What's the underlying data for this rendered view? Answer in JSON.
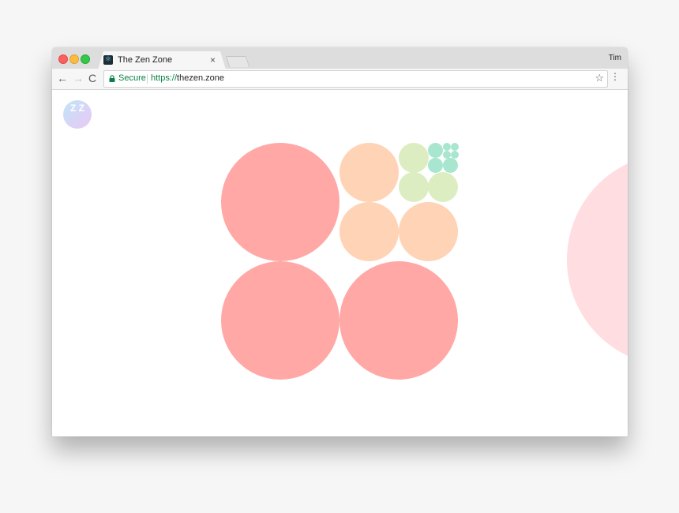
{
  "browser": {
    "tab_title": "The Zen Zone",
    "tab_close": "×",
    "profile_name": "Tim",
    "secure_label": "Secure",
    "url_scheme": "https://",
    "url_host": "thezen.zone",
    "icons": {
      "back": "←",
      "forward": "→",
      "reload": "C",
      "star": "☆",
      "menu": "⋮",
      "favicon": "⚛"
    }
  },
  "page": {
    "logo_text": "Z Z",
    "colors": {
      "large": "#ffa8a6",
      "medium": "#ffd3b6",
      "small": "#dcedc1",
      "tiny": "#a8e6cf",
      "side": "#ffdde1"
    }
  }
}
